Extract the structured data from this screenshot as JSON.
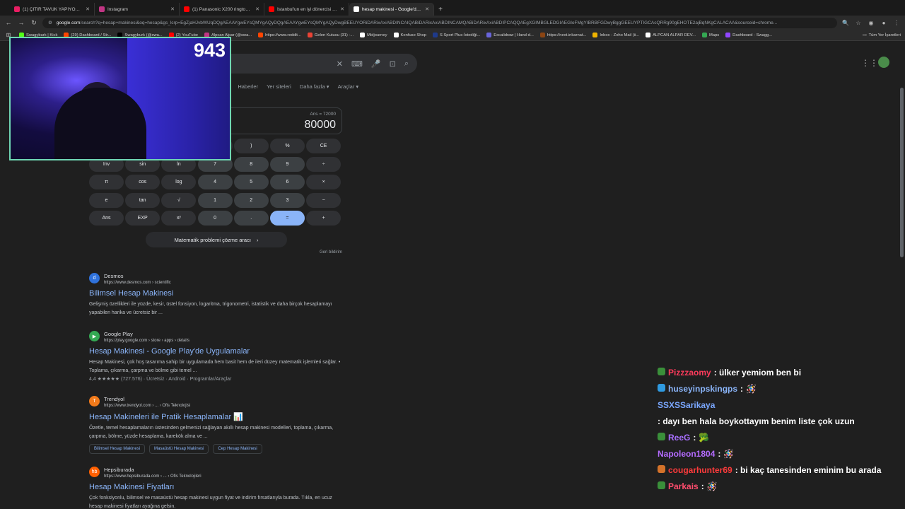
{
  "tabs": [
    {
      "title": "(1) ÇITIR TAVUK YAPIYORUZ 🐔",
      "fav_color": "#e91e63"
    },
    {
      "title": "Instagram",
      "fav_color": "#c13584"
    },
    {
      "title": "(1) Panasonic X200 ringtones",
      "fav_color": "#ff0000"
    },
    {
      "title": "İstanbul'un en iyi dönercisi Sü",
      "fav_color": "#ff0000"
    },
    {
      "title": "hesap makinesi - Google'da Ar",
      "fav_color": "#ffffff"
    }
  ],
  "omnibox": {
    "host": "google.com",
    "path": "/search?q=hesap+makinesi&oq=hesap&gs_lcrp=EgZjaHJvbWUqDQgAEAAYgwEYsQMYgAQyDQgAEAAYgwEYsQMYgAQyDwgBEEUYORiDARixAxiABDINCAIQABiDARixAxiABDINCAMQABiDARixAxiABDIPCAQQAEgXGIMBGLEDGIAEGIoFMgYIBRBFGDwyBggGEEUYPTIGCAcQRRg90gEHOTE2ajBqNKgCALACAA&sourceid=chrome..."
  },
  "bookmarks": [
    {
      "label": "Swagyburk | Kick",
      "color": "#53fc18"
    },
    {
      "label": "(29) Dashboard / Str...",
      "color": "#ff4500"
    },
    {
      "label": "Swagyburk (@swa...",
      "color": "#000000"
    },
    {
      "label": "(2) YouTube",
      "color": "#ff0000"
    },
    {
      "label": "Alpcan Alpar (@swa...",
      "color": "#c13584"
    },
    {
      "label": "https://www.reddit...",
      "color": "#ff4500"
    },
    {
      "label": "Gelen Kutusu (31) -...",
      "color": "#ea4335"
    },
    {
      "label": "Midjourney",
      "color": "#ffffff"
    },
    {
      "label": "Konfuse Shop",
      "color": "#ffffff"
    },
    {
      "label": "S Sport Plus-İstediği...",
      "color": "#1e3a8a"
    },
    {
      "label": "Excalidraw | Hand-d...",
      "color": "#6965db"
    },
    {
      "label": "https://next.inkarnat...",
      "color": "#8b4513"
    },
    {
      "label": "Inbox - Zoho Mail (ii...",
      "color": "#f0b400"
    },
    {
      "label": "ALPCAN ALPAR DEV...",
      "color": "#ffffff"
    },
    {
      "label": "Maps",
      "color": "#34a853"
    },
    {
      "label": "Dashboard - Swagg...",
      "color": "#9146ff"
    }
  ],
  "bookmarks_all": "Tüm Yer İşaretleri",
  "filters": [
    "lar",
    "Haberler",
    "Yer siteleri",
    "Daha fazla ▾",
    "Araçlar ▾"
  ],
  "calculator": {
    "ans_line": "Ans = 72000",
    "result": "80000",
    "keys": [
      [
        "(",
        ")",
        "%",
        "CE"
      ],
      [
        "Inv",
        "sin",
        "ln",
        "7",
        "8",
        "9",
        "÷"
      ],
      [
        "π",
        "cos",
        "log",
        "4",
        "5",
        "6",
        "×"
      ],
      [
        "e",
        "tan",
        "√",
        "1",
        "2",
        "3",
        "−"
      ],
      [
        "Ans",
        "EXP",
        "xʸ",
        "0",
        ".",
        "=",
        "+"
      ]
    ],
    "math_solver": "Matematik problemi çözme aracı",
    "feedback": "Geri bildirim"
  },
  "results": [
    {
      "name": "Desmos",
      "url": "https://www.desmos.com › scientific",
      "title": "Bilimsel Hesap Makinesi",
      "snippet": "Gelişmiş özellikleri ile yüzde, kesir, üstel fonsiyon, logaritma, trigonometri, istatistik ve daha birçok hesaplamayı yapabilen harika ve ücretsiz bir ...",
      "fav": "d",
      "fav_color": "#2f72dc"
    },
    {
      "name": "Google Play",
      "url": "https://play.google.com › store › apps › details",
      "title": "Hesap Makinesi - Google Play'de Uygulamalar",
      "snippet": "Hesap Makinesi, çok hoş tasarıma sahip bir uygulamada hem basit hem de ileri düzey matematik işlemleri sağlar. • Toplama, çıkarma, çarpma ve bölme gibi temel ...",
      "rating": "4,4 ★★★★★ (727.576) · Ücretsiz · Android · Programlar/Araçlar",
      "fav": "▶",
      "fav_color": "#34a853"
    },
    {
      "name": "Trendyol",
      "url": "https://www.trendyol.com › ... › Ofis Teknolojisi",
      "title": "Hesap Makineleri ile Pratik Hesaplamalar 📊",
      "snippet": "Özetle, temel hesaplamaların üstesinden gelmenizi sağlayan akıllı hesap makinesi modelleri, toplama, çıkarma, çarpma, bölme, yüzde hesaplama, karekök alma ve ...",
      "chips": [
        "Bilimsel Hesap Makinesi",
        "Masaüstü Hesap Makinesi",
        "Cep Hesap Makinesi"
      ],
      "fav": "T",
      "fav_color": "#f27a1a"
    },
    {
      "name": "Hepsiburada",
      "url": "https://www.hepsiburada.com › ... › Ofis Teknolojileri",
      "title": "Hesap Makinesi Fiyatları",
      "snippet": "Çok fonksiyonlu, bilimsel ve masaüstü hesap makinesi uygun fiyat ve indirim fırsatlarıyla burada. Tıkla, en ucuz hesap makinesi fiyatları ayağına gelsin.",
      "fav": "hb",
      "fav_color": "#ff6000"
    }
  ],
  "webcam": {
    "counter": "943"
  },
  "chat": [
    {
      "user": "Pizzzaomy",
      "color": "#ff3b5c",
      "badge": "#3a8f3a",
      "text": ": ülker yemiom ben bi",
      "emote": ""
    },
    {
      "user": "huseyinpskingps",
      "color": "#8ab4f8",
      "badge": "#2f9ae0",
      "text": ":",
      "emote": "🪅"
    },
    {
      "user": "SSXSSarikaya",
      "color": "#7aa7ff",
      "badge": "",
      "text": ": dayı ben hala boykottayım benim liste çok uzun",
      "emote": ""
    },
    {
      "user": "ReeG",
      "color": "#a970ff",
      "badge": "#3a8f3a",
      "text": ":",
      "emote": "🥦"
    },
    {
      "user": "Napoleon1804",
      "color": "#b46bff",
      "badge": "",
      "text": ":",
      "emote": "🪅"
    },
    {
      "user": "cougarhunter69",
      "color": "#ff3b3b",
      "badge": "#d4722a",
      "text": ": bi kaç tanesinden eminim bu arada",
      "emote": ""
    },
    {
      "user": "Parkais",
      "color": "#ff4d6d",
      "badge": "#3a8f3a",
      "text": ":",
      "emote": "🪅"
    }
  ]
}
